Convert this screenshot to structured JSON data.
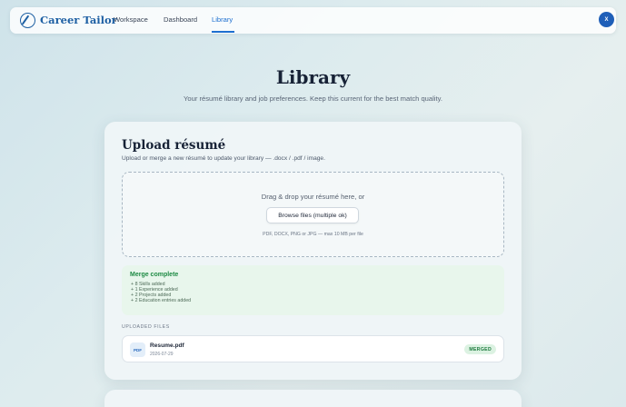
{
  "nav": {
    "brand": "Career Tailor",
    "links": [
      {
        "label": "Workspace"
      },
      {
        "label": "Dashboard"
      },
      {
        "label": "Library",
        "active": true
      }
    ],
    "avatar_initial": "X",
    "accent": "#1d6fd0"
  },
  "page": {
    "title": "Library",
    "subtitle": "Your résumé library and job preferences. Keep this current for the best match quality."
  },
  "upload": {
    "title": "Upload résumé",
    "subtitle": "Upload or merge a new résumé to update your library — .docx / .pdf / image.",
    "dropzone_text": "Drag & drop your résumé here, or",
    "browse_label": "Browse files (multiple ok)",
    "hint": "PDF, DOCX, PNG or JPG — max 10 MB per file"
  },
  "merge": {
    "title": "Merge complete",
    "items": [
      "+ 8 Skills added",
      "+ 1 Experience added",
      "+ 2 Projects added",
      "+ 2 Education entries added"
    ],
    "color": "#1d8a43"
  },
  "files": {
    "label": "UPLOADED FILES",
    "items": [
      {
        "type": "PDF",
        "name": "Resume.pdf",
        "date": "2026-07-29",
        "status": "MERGED"
      }
    ]
  }
}
